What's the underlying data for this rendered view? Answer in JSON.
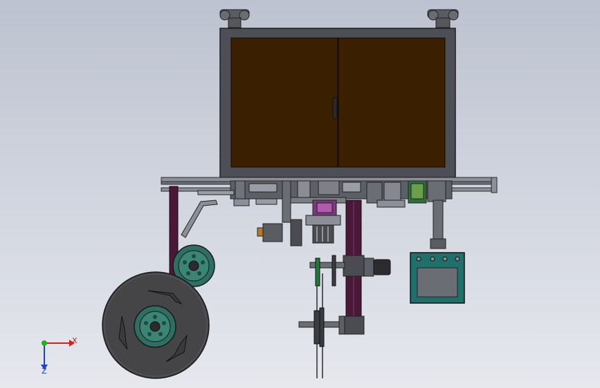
{
  "viewport": {
    "background_top": "#bcc2cf",
    "background_bottom": "#e6e8ee"
  },
  "model": {
    "cabinet_door_color": "#3a2000",
    "frame_color": "#4d4f56",
    "accent_purple": "#4a1838",
    "control_box_color": "#1f6f6a",
    "wheel_color": "#454548",
    "hub_color": "#2f6f63"
  },
  "triad": {
    "x_label": "X",
    "z_label": "Z",
    "x_color": "#d02020",
    "y_color": "#20b020",
    "z_color": "#2040d0"
  }
}
